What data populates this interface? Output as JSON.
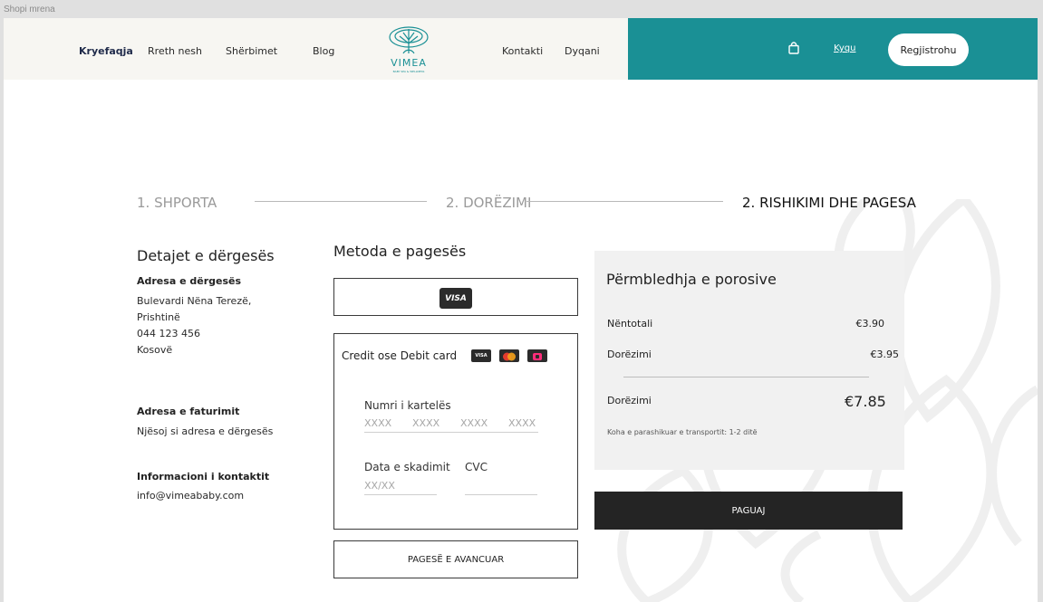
{
  "frame": {
    "label": "Shopi mrena"
  },
  "nav": {
    "home": "Kryefaqja",
    "about": "Rreth nesh",
    "services": "Shërbimet",
    "blog": "Blog",
    "contact": "Kontakti",
    "shop": "Dyqani",
    "login": "Kyqu",
    "register": "Regjistrohu"
  },
  "logo": {
    "name": "VIMEA",
    "tagline": "BABY SPA & WELLNESS"
  },
  "steps": [
    "1. SHPORTA",
    "2. DORËZIMI",
    "2. RISHIKIMI DHE PAGESA"
  ],
  "shipping": {
    "title": "Detajet e dërgesës",
    "address_heading": "Adresa e dërgesës",
    "address_lines": [
      "Bulevardi Nëna Terezë,",
      "Prishtinë",
      "044 123 456",
      "Kosovë"
    ],
    "billing_heading": "Adresa e faturimit",
    "billing_text": "Njësoj si adresa e dërgesës",
    "contact_heading": "Informacioni i kontaktit",
    "contact_email": "info@vimeababy.com"
  },
  "payment": {
    "title": "Metoda e pagesës",
    "visa_label": "VISA",
    "card_title": "Credit ose Debit card",
    "mini_visa": "VISA",
    "card_number_label": "Numri i kartelës",
    "card_number_placeholder": [
      "XXXX",
      "XXXX",
      "XXXX",
      "XXXX"
    ],
    "expiry_label": "Data e skadimit",
    "expiry_placeholder": "XX/XX",
    "cvc_label": "CVC",
    "advanced_button": "PAGESË E AVANCUAR"
  },
  "summary": {
    "title": "Përmbledhja e porosive",
    "subtotal_label": "Nëntotali",
    "subtotal_value": "€3.90",
    "delivery_label": "Dorëzimi",
    "delivery_value": "€3.95",
    "total_label": "Dorëzimi",
    "total_value": "€7.85",
    "note": "Koha e parashikuar e transportit: 1-2 ditë",
    "pay_button": "PAGUAJ"
  },
  "colors": {
    "teal": "#1a9095",
    "dark": "#242424",
    "cream": "#f7f6f2",
    "summary_bg": "#f1f1f1"
  }
}
